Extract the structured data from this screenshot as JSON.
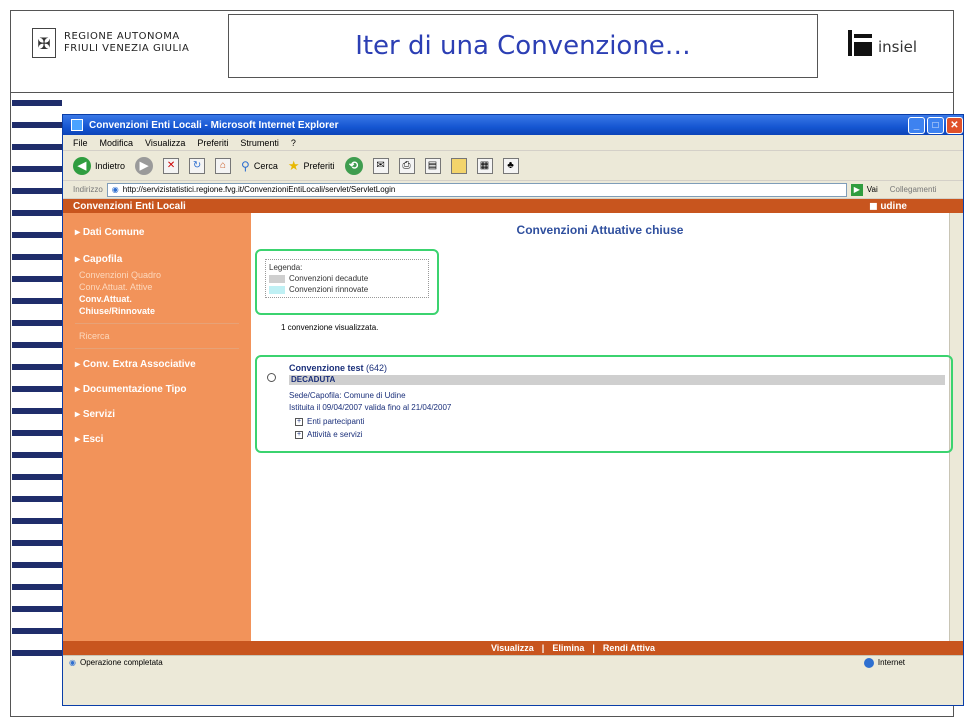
{
  "slide": {
    "region_logo_line1": "REGIONE AUTONOMA",
    "region_logo_line2": "FRIULI VENEZIA GIULIA",
    "title": "Iter di una Convenzione…",
    "brand": "insiel"
  },
  "browser": {
    "window_title": "Convenzioni Enti Locali - Microsoft Internet Explorer",
    "menu": [
      "File",
      "Modifica",
      "Visualizza",
      "Preferiti",
      "Strumenti",
      "?"
    ],
    "toolbar": {
      "back": "Indietro",
      "search": "Cerca",
      "favorites": "Preferiti"
    },
    "address_label": "Indirizzo",
    "address_url": "http://servizistatistici.regione.fvg.it/ConvenzioniEntiLocali/servlet/ServletLogin",
    "go_label": "Vai",
    "links_label": "Collegamenti",
    "status_text": "Operazione completata",
    "zone_text": "Internet"
  },
  "app": {
    "header_title": "Convenzioni Enti Locali",
    "user": "udine",
    "sidebar": {
      "sections": [
        {
          "label": "Dati Comune"
        },
        {
          "label": "Capofila",
          "links": [
            {
              "label": "Convenzioni Quadro",
              "active": false
            },
            {
              "label": "Conv.Attuat. Attive",
              "active": false
            },
            {
              "label": "Conv.Attuat.",
              "active": true
            },
            {
              "label": "Chiuse/Rinnovate",
              "active": true
            }
          ]
        },
        {
          "label": "Ricerca"
        },
        {
          "label": "Conv. Extra Associative"
        },
        {
          "label": "Documentazione Tipo"
        },
        {
          "label": "Servizi"
        },
        {
          "label": "Esci"
        }
      ]
    },
    "page_heading": "Convenzioni Attuative chiuse",
    "legend": {
      "title": "Legenda:",
      "items": [
        {
          "label": "Convenzioni decadute",
          "color": "#cfcfcf"
        },
        {
          "label": "Convenzioni rinnovate",
          "color": "#bff0f4"
        }
      ]
    },
    "count_text": "1 convenzione visualizzata.",
    "convention": {
      "name": "Convenzione test",
      "code": "(642)",
      "status": "DECADUTA",
      "seat": "Sede/Capofila: Comune di Udine",
      "validity": "Istituita il 09/04/2007 valida fino al 21/04/2007",
      "expanders": [
        "Enti partecipanti",
        "Attività e servizi"
      ]
    },
    "footer_actions": [
      "Visualizza",
      "|",
      "Elimina",
      "|",
      "Rendi Attiva"
    ]
  },
  "colors": {
    "accent_orange": "#c8551e",
    "sidebar_orange": "#f2935a",
    "highlight_green": "#3bd36f",
    "title_blue": "#2c3fb4"
  }
}
